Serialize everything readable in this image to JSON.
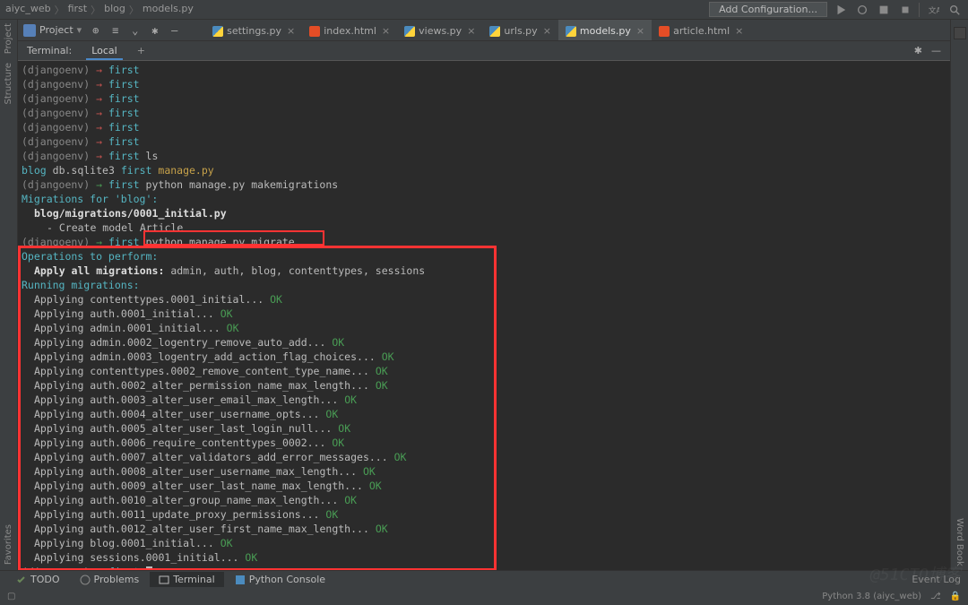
{
  "breadcrumbs": [
    "aiyc_web",
    "first",
    "blog",
    "models.py"
  ],
  "toolbar": {
    "add_config": "Add Configuration...",
    "project_label": "Project"
  },
  "tabs": [
    {
      "label": "settings.py",
      "type": "py",
      "active": false
    },
    {
      "label": "index.html",
      "type": "html",
      "active": false
    },
    {
      "label": "views.py",
      "type": "py",
      "active": false
    },
    {
      "label": "urls.py",
      "type": "py",
      "active": false
    },
    {
      "label": "models.py",
      "type": "py",
      "active": true
    },
    {
      "label": "article.html",
      "type": "html",
      "active": false
    }
  ],
  "sidetools_left": [
    {
      "label": "Project"
    },
    {
      "label": "Structure"
    },
    {
      "label": "Favorites"
    }
  ],
  "sidetools_right": [
    {
      "label": "Word Book"
    }
  ],
  "terminal_panel": {
    "title": "Terminal:",
    "local_tab": "Local",
    "plus": "+"
  },
  "bottom": {
    "todo": "TODO",
    "problems": "Problems",
    "terminal": "Terminal",
    "pyconsole": "Python Console",
    "event_log": "Event Log"
  },
  "status": {
    "interpreter": "Python 3.8 (aiyc_web)"
  },
  "prompts": [
    {
      "env": "(djangoenv)",
      "arrow": "→",
      "dir": "first",
      "cmd": ""
    },
    {
      "env": "(djangoenv)",
      "arrow": "→",
      "dir": "first",
      "cmd": ""
    },
    {
      "env": "(djangoenv)",
      "arrow": "→",
      "dir": "first",
      "cmd": ""
    },
    {
      "env": "(djangoenv)",
      "arrow": "→",
      "dir": "first",
      "cmd": ""
    },
    {
      "env": "(djangoenv)",
      "arrow": "→",
      "dir": "first",
      "cmd": ""
    },
    {
      "env": "(djangoenv)",
      "arrow": "→",
      "dir": "first",
      "cmd": ""
    },
    {
      "env": "(djangoenv)",
      "arrow": "→",
      "dir": "first",
      "cmd": "ls"
    }
  ],
  "ls_output": {
    "blog": "blog",
    "db": "db.sqlite3",
    "first": "first",
    "manage": "manage.py"
  },
  "prompt_make": {
    "env": "(djangoenv)",
    "arrow": "→",
    "dir": "first",
    "cmd": "python manage.py makemigrations"
  },
  "make_header": "Migrations for 'blog':",
  "make_file": "blog/migrations/0001_initial.py",
  "make_action": "- Create model Article",
  "prompt_migrate": {
    "env": "(djangoenv)",
    "arrow": "→",
    "dir": "first",
    "cmd": "python manage.py migrate"
  },
  "ops_header": "Operations to perform:",
  "apply_label": "Apply all migrations:",
  "apply_list": " admin, auth, blog, contenttypes, sessions",
  "running_header": "Running migrations:",
  "migrations": [
    "Applying contenttypes.0001_initial...",
    "Applying auth.0001_initial...",
    "Applying admin.0001_initial...",
    "Applying admin.0002_logentry_remove_auto_add...",
    "Applying admin.0003_logentry_add_action_flag_choices...",
    "Applying contenttypes.0002_remove_content_type_name...",
    "Applying auth.0002_alter_permission_name_max_length...",
    "Applying auth.0003_alter_user_email_max_length...",
    "Applying auth.0004_alter_user_username_opts...",
    "Applying auth.0005_alter_user_last_login_null...",
    "Applying auth.0006_require_contenttypes_0002...",
    "Applying auth.0007_alter_validators_add_error_messages...",
    "Applying auth.0008_alter_user_username_max_length...",
    "Applying auth.0009_alter_user_last_name_max_length...",
    "Applying auth.0010_alter_group_name_max_length...",
    "Applying auth.0011_update_proxy_permissions...",
    "Applying auth.0012_alter_user_first_name_max_length...",
    "Applying blog.0001_initial...",
    "Applying sessions.0001_initial..."
  ],
  "ok": "OK",
  "prompt_final": {
    "env": "(djangoenv)",
    "arrow": "→",
    "dir": "first"
  },
  "watermark": "@51CTO博客"
}
